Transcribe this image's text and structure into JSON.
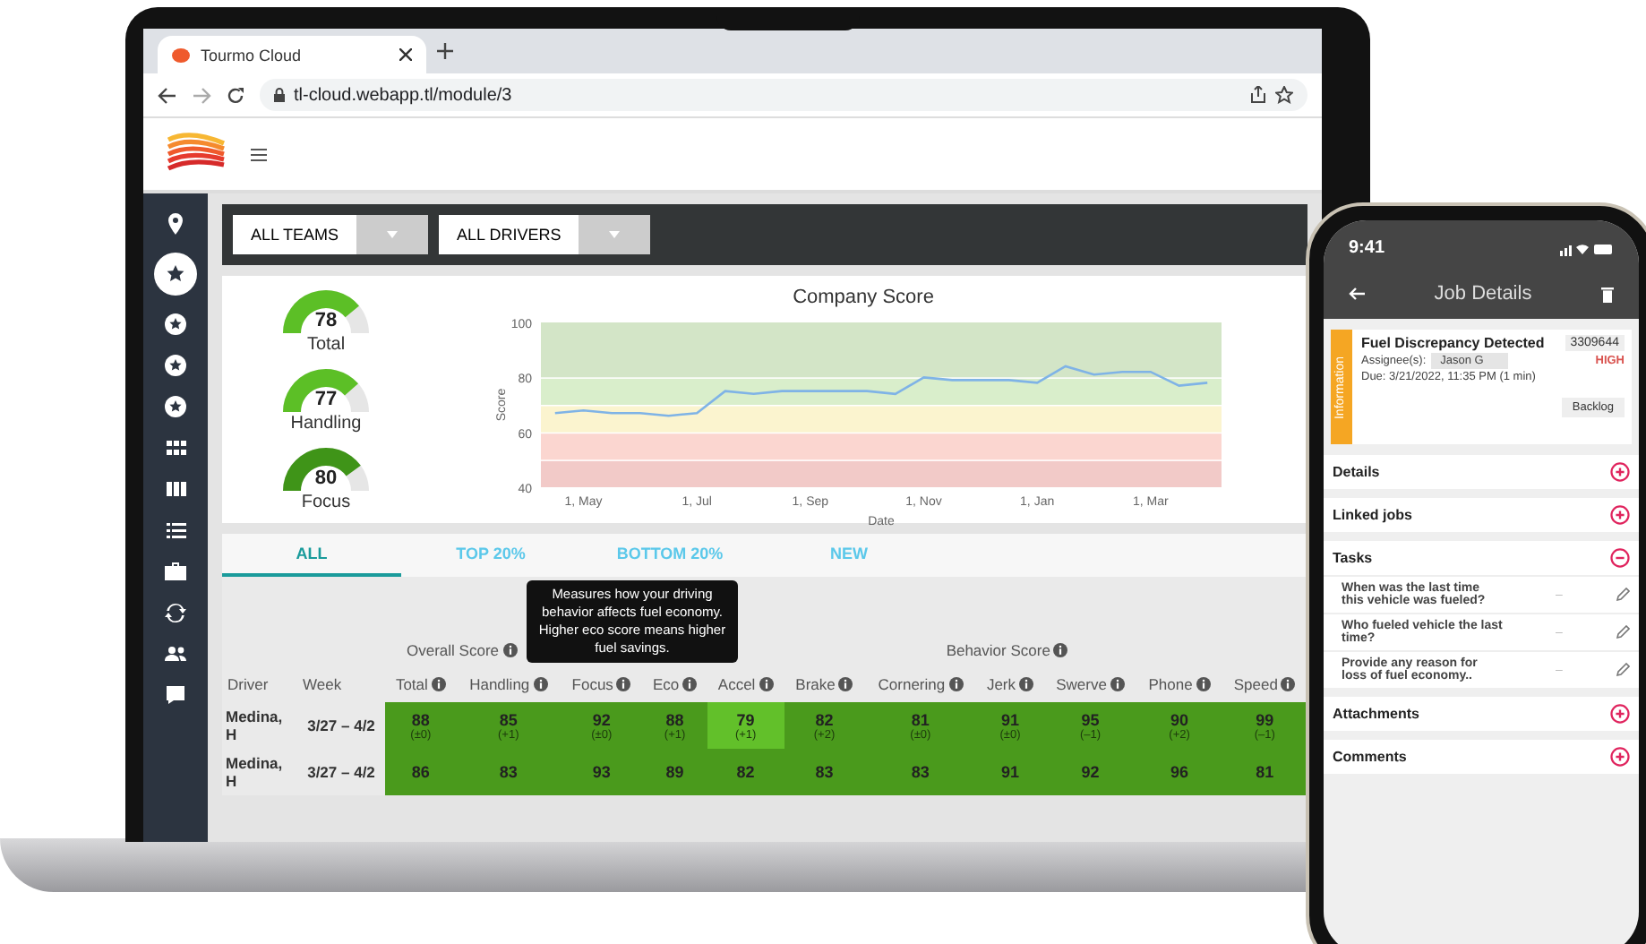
{
  "browser": {
    "tab_title": "Tourmo Cloud",
    "url": "tl-cloud.webapp.tl/module/3"
  },
  "sidebar": {
    "items": [
      {
        "kind": "pin",
        "selected": false
      },
      {
        "kind": "star",
        "selected": true
      },
      {
        "kind": "star",
        "selected": false
      },
      {
        "kind": "star",
        "selected": false
      },
      {
        "kind": "star",
        "selected": false
      },
      {
        "kind": "grid",
        "selected": false
      },
      {
        "kind": "columns",
        "selected": false
      },
      {
        "kind": "list",
        "selected": false
      },
      {
        "kind": "briefcase",
        "selected": false
      },
      {
        "kind": "sync",
        "selected": false
      },
      {
        "kind": "people",
        "selected": false
      },
      {
        "kind": "chat",
        "selected": false
      }
    ]
  },
  "filters": [
    "ALL TEAMS",
    "ALL DRIVERS"
  ],
  "gauges": [
    {
      "value": "78",
      "label": "Total",
      "level": 0.78,
      "color": "#5cbf26"
    },
    {
      "value": "77",
      "label": "Handling",
      "level": 0.77,
      "color": "#5cbf26"
    },
    {
      "value": "80",
      "label": "Focus",
      "level": 0.8,
      "color": "#3f9418"
    }
  ],
  "chart_data": {
    "type": "line",
    "title": "Company Score",
    "xlabel": "Date",
    "ylabel": "Score",
    "ylim": [
      40,
      100
    ],
    "yticks": [
      40,
      60,
      80,
      100
    ],
    "categories": [
      null,
      "1, May",
      null,
      null,
      null,
      "1, Jul",
      null,
      null,
      null,
      "1, Sep",
      null,
      null,
      null,
      "1, Nov",
      null,
      null,
      null,
      "1, Jan",
      null,
      null,
      null,
      "1, Mar",
      null,
      null
    ],
    "series": [
      {
        "color": "#7fb3e6",
        "values": [
          67,
          68,
          67,
          67,
          66,
          67,
          75,
          74,
          75,
          75,
          75,
          75,
          74,
          80,
          79,
          79,
          79,
          78,
          84,
          81,
          82,
          82,
          77,
          78
        ]
      }
    ]
  },
  "tabs": [
    {
      "label": "ALL",
      "selected": true
    },
    {
      "label": "TOP 20%",
      "selected": false
    },
    {
      "label": "BOTTOM 20%",
      "selected": false
    },
    {
      "label": "NEW",
      "selected": false
    }
  ],
  "table": {
    "groups": [
      {
        "label": "Overall Score",
        "kind": "overall"
      },
      {
        "label": "Behavior Score",
        "kind": "behavior"
      }
    ],
    "columns": [
      {
        "label": "Driver",
        "kind": "text"
      },
      {
        "label": "Week",
        "kind": "text"
      },
      {
        "label": "Total",
        "kind": "score"
      },
      {
        "label": "Handling",
        "kind": "score"
      },
      {
        "label": "Focus",
        "kind": "score"
      },
      {
        "label": "Eco",
        "kind": "score"
      },
      {
        "label": "Accel",
        "kind": "score"
      },
      {
        "label": "Brake",
        "kind": "score"
      },
      {
        "label": "Cornering",
        "kind": "score"
      },
      {
        "label": "Jerk",
        "kind": "score"
      },
      {
        "label": "Swerve",
        "kind": "score"
      },
      {
        "label": "Phone",
        "kind": "score"
      },
      {
        "label": "Speed",
        "kind": "score"
      }
    ],
    "tooltip": "Measures how your driving behavior affects fuel economy. Higher eco score means higher fuel savings.",
    "rows": [
      {
        "cells": [
          {
            "value": "Medina, H",
            "kind": "driver"
          },
          {
            "value": "3/27 – 4/2",
            "kind": "week"
          },
          {
            "value": "88",
            "change": "(±0)",
            "color": "#4a9a1c"
          },
          {
            "value": "85",
            "change": "(+1)",
            "color": "#4a9a1c"
          },
          {
            "value": "92",
            "change": "(±0)",
            "color": "#4a9a1c"
          },
          {
            "value": "88",
            "change": "(+1)",
            "color": "#4a9a1c"
          },
          {
            "value": "79",
            "change": "(+1)",
            "color": "#62c02a"
          },
          {
            "value": "82",
            "change": "(+2)",
            "color": "#4a9a1c"
          },
          {
            "value": "81",
            "change": "(±0)",
            "color": "#4a9a1c"
          },
          {
            "value": "91",
            "change": "(±0)",
            "color": "#4a9a1c"
          },
          {
            "value": "95",
            "change": "(–1)",
            "color": "#4a9a1c"
          },
          {
            "value": "90",
            "change": "(+2)",
            "color": "#4a9a1c"
          },
          {
            "value": "99",
            "change": "(–1)",
            "color": "#4a9a1c"
          }
        ]
      },
      {
        "cells": [
          {
            "value": "Medina, H",
            "kind": "driver"
          },
          {
            "value": "3/27 – 4/2",
            "kind": "week"
          },
          {
            "value": "86",
            "color": "#4a9a1c"
          },
          {
            "value": "83",
            "color": "#4a9a1c"
          },
          {
            "value": "93",
            "color": "#4a9a1c"
          },
          {
            "value": "89",
            "color": "#4a9a1c"
          },
          {
            "value": "82",
            "color": "#4a9a1c"
          },
          {
            "value": "83",
            "color": "#4a9a1c"
          },
          {
            "value": "83",
            "color": "#4a9a1c"
          },
          {
            "value": "91",
            "color": "#4a9a1c"
          },
          {
            "value": "92",
            "color": "#4a9a1c"
          },
          {
            "value": "96",
            "color": "#4a9a1c"
          },
          {
            "value": "81",
            "color": "#4a9a1c"
          }
        ]
      }
    ]
  },
  "phone": {
    "time": "9:41",
    "title": "Job Details",
    "job": {
      "tag": "Information",
      "title": "Fuel Discrepancy Detected",
      "id": "3309644",
      "assignee_label": "Assignee(s):",
      "assignee": "Jason G",
      "priority": "HIGH",
      "due": "Due: 3/21/2022, 11:35 PM (1 min)",
      "status": "Backlog"
    },
    "sections": [
      {
        "label": "Details",
        "expanded": false
      },
      {
        "label": "Linked jobs",
        "expanded": false
      },
      {
        "label": "Tasks",
        "expanded": true,
        "tasks": [
          {
            "text": "When was the last time this vehicle was fueled?",
            "answer": "–"
          },
          {
            "text": "Who fueled vehicle the last time?",
            "answer": "–"
          },
          {
            "text": "Provide any reason for loss of fuel economy..",
            "answer": "–"
          }
        ]
      },
      {
        "label": "Attachments",
        "expanded": false
      },
      {
        "label": "Comments",
        "expanded": false
      }
    ]
  }
}
